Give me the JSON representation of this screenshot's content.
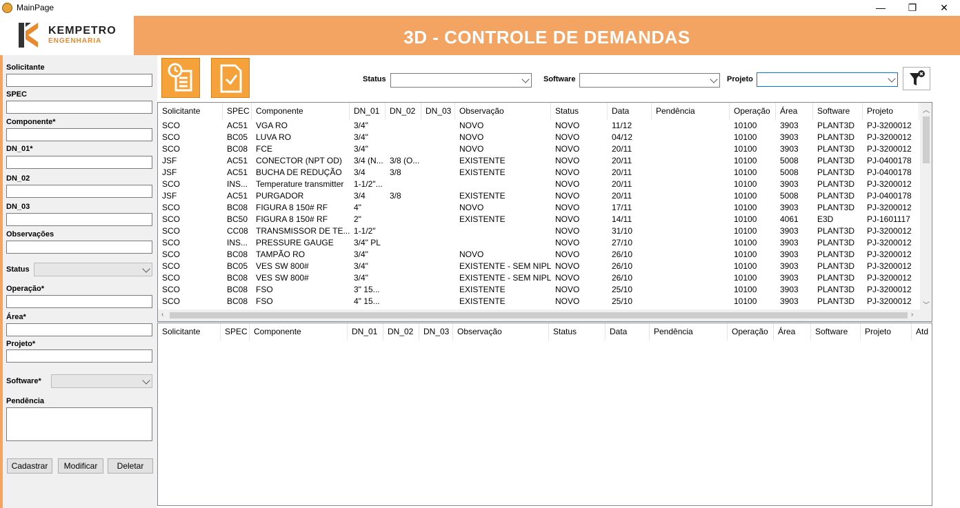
{
  "window": {
    "title": "MainPage",
    "minimize": "—",
    "restore": "❐",
    "close": "✕"
  },
  "logo": {
    "name": "KEMPETRO",
    "sub": "ENGENHARIA"
  },
  "banner": {
    "title": "3D - CONTROLE DE DEMANDAS"
  },
  "form": {
    "solicitante_label": "Solicitante",
    "spec_label": "SPEC",
    "componente_label": "Componente*",
    "dn01_label": "DN_01*",
    "dn02_label": "DN_02",
    "dn03_label": "DN_03",
    "observacoes_label": "Observações",
    "status_label": "Status",
    "operacao_label": "Operação*",
    "area_label": "Área*",
    "projeto_label": "Projeto*",
    "software_label": "Software*",
    "pendencia_label": "Pendência",
    "cadastrar": "Cadastrar",
    "modificar": "Modificar",
    "deletar": "Deletar"
  },
  "filters": {
    "status_label": "Status",
    "software_label": "Software",
    "projeto_label": "Projeto"
  },
  "grid": {
    "columns": [
      "Solicitante",
      "SPEC",
      "Componente",
      "DN_01",
      "DN_02",
      "DN_03",
      "Observação",
      "Status",
      "Data",
      "Pendência",
      "Operação",
      "Área",
      "Software",
      "Projeto"
    ],
    "rows": [
      [
        "SCO",
        "AC51",
        "VGA RO",
        "3/4\"",
        "",
        "",
        "NOVO",
        "NOVO",
        "11/12",
        "",
        "10100",
        "3903",
        "PLANT3D",
        "PJ-3200012"
      ],
      [
        "SCO",
        "BC05",
        "LUVA RO",
        "3/4\"",
        "",
        "",
        "NOVO",
        "NOVO",
        "04/12",
        "",
        "10100",
        "3903",
        "PLANT3D",
        "PJ-3200012"
      ],
      [
        "SCO",
        "BC08",
        "FCE",
        "3/4\"",
        "",
        "",
        "NOVO",
        "NOVO",
        "20/11",
        "",
        "10100",
        "3903",
        "PLANT3D",
        "PJ-3200012"
      ],
      [
        "JSF",
        "AC51",
        "CONECTOR (NPT OD)",
        "3/4 (N...",
        "3/8 (O...",
        "",
        "EXISTENTE",
        "NOVO",
        "20/11",
        "",
        "10100",
        "5008",
        "PLANT3D",
        "PJ-0400178"
      ],
      [
        "JSF",
        "AC51",
        "BUCHA DE REDUÇÃO",
        "3/4",
        "3/8",
        "",
        "EXISTENTE",
        "NOVO",
        "20/11",
        "",
        "10100",
        "5008",
        "PLANT3D",
        "PJ-0400178"
      ],
      [
        "SCO",
        "INS...",
        "Temperature transmitter",
        "1-1/2\"...",
        "",
        "",
        "",
        "NOVO",
        "20/11",
        "",
        "10100",
        "3903",
        "PLANT3D",
        "PJ-3200012"
      ],
      [
        "JSF",
        "AC51",
        "PURGADOR",
        "3/4",
        "3/8",
        "",
        "EXISTENTE",
        "NOVO",
        "20/11",
        "",
        "10100",
        "5008",
        "PLANT3D",
        "PJ-0400178"
      ],
      [
        "SCO",
        "BC08",
        "FIGURA 8 150# RF",
        "4\"",
        "",
        "",
        "NOVO",
        "NOVO",
        "17/11",
        "",
        "10100",
        "3903",
        "PLANT3D",
        "PJ-3200012"
      ],
      [
        "SCO",
        "BC50",
        "FIGURA 8 150# RF",
        "2\"",
        "",
        "",
        "EXISTENTE",
        "NOVO",
        "14/11",
        "",
        "10100",
        "4061",
        "E3D",
        "PJ-1601117"
      ],
      [
        "SCO",
        "CC08",
        "TRANSMISSOR DE TE...",
        "1-1/2\"",
        "",
        "",
        "",
        "NOVO",
        "31/10",
        "",
        "10100",
        "3903",
        "PLANT3D",
        "PJ-3200012"
      ],
      [
        "SCO",
        "INS...",
        "PRESSURE GAUGE",
        "3/4\" PL",
        "",
        "",
        "",
        "NOVO",
        "27/10",
        "",
        "10100",
        "3903",
        "PLANT3D",
        "PJ-3200012"
      ],
      [
        "SCO",
        "BC08",
        "TAMPÃO RO",
        "3/4\"",
        "",
        "",
        "NOVO",
        "NOVO",
        "26/10",
        "",
        "10100",
        "3903",
        "PLANT3D",
        "PJ-3200012"
      ],
      [
        "SCO",
        "BC05",
        "VES SW 800#",
        "3/4\"",
        "",
        "",
        "EXISTENTE - SEM NIPLE",
        "NOVO",
        "26/10",
        "",
        "10100",
        "3903",
        "PLANT3D",
        "PJ-3200012"
      ],
      [
        "SCO",
        "BC08",
        "VES SW 800#",
        "3/4\"",
        "",
        "",
        "EXISTENTE - SEM NIPLE",
        "NOVO",
        "26/10",
        "",
        "10100",
        "3903",
        "PLANT3D",
        "PJ-3200012"
      ],
      [
        "SCO",
        "BC08",
        "FSO",
        "3\" 15...",
        "",
        "",
        "EXISTENTE",
        "NOVO",
        "25/10",
        "",
        "10100",
        "3903",
        "PLANT3D",
        "PJ-3200012"
      ],
      [
        "SCO",
        "BC08",
        "FSO",
        "4\" 15...",
        "",
        "",
        "EXISTENTE",
        "NOVO",
        "25/10",
        "",
        "10100",
        "3903",
        "PLANT3D",
        "PJ-3200012"
      ]
    ]
  },
  "grid2": {
    "columns": [
      "Solicitante",
      "SPEC",
      "Componente",
      "DN_01",
      "DN_02",
      "DN_03",
      "Observação",
      "Status",
      "Data",
      "Pendência",
      "Operação",
      "Área",
      "Software",
      "Projeto",
      "Atd"
    ]
  },
  "colors": {
    "banner": "#f4a462",
    "accent_button": "#f6a23a"
  },
  "icons": {
    "history": "history-document-icon",
    "approve": "approve-document-icon",
    "clear_filter": "clear-filter-icon"
  }
}
